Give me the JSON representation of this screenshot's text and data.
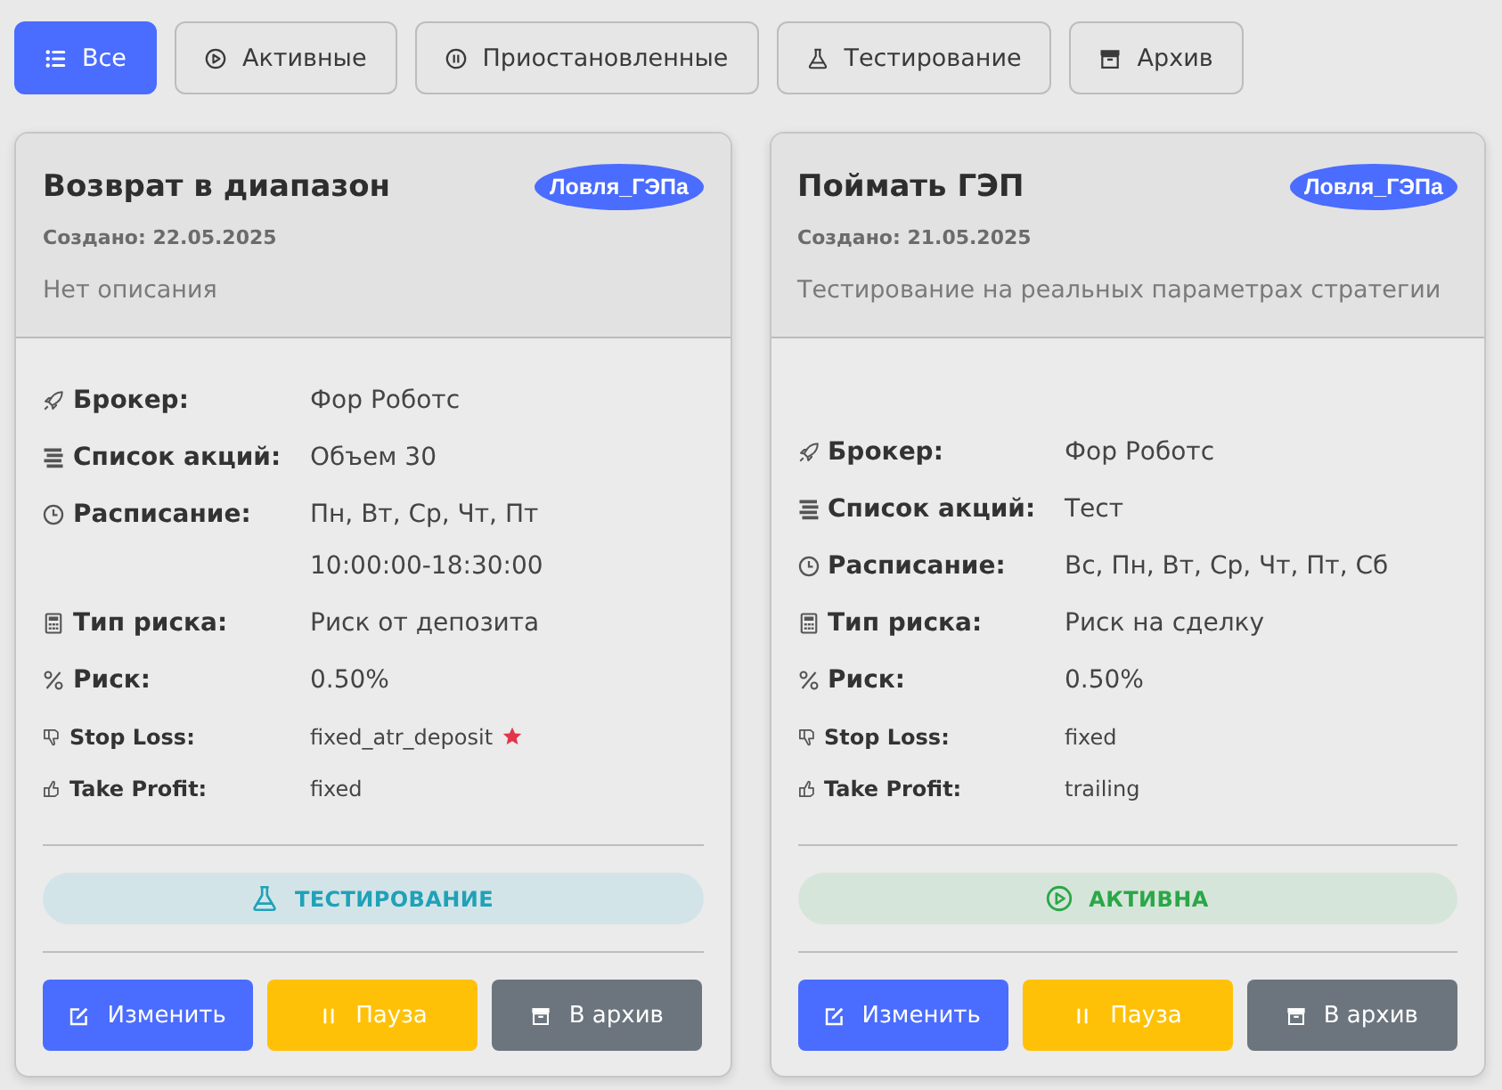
{
  "filters": [
    {
      "kind": "all",
      "label": "Все",
      "selected": true
    },
    {
      "kind": "active",
      "label": "Активные",
      "selected": false
    },
    {
      "kind": "paused",
      "label": "Приостановленные",
      "selected": false
    },
    {
      "kind": "testing",
      "label": "Тестирование",
      "selected": false
    },
    {
      "kind": "archive",
      "label": "Архив",
      "selected": false
    }
  ],
  "cards": [
    {
      "title": "Возврат в диапазон",
      "tag": "Ловля_ГЭПа",
      "created": "Создано: 22.05.2025",
      "description": "Нет описания",
      "details": [
        {
          "kind": "broker",
          "label": "Брокер:",
          "values": [
            "Фор Роботс"
          ],
          "starred": false
        },
        {
          "kind": "stocks",
          "label": "Список акций:",
          "values": [
            "Объем 30"
          ],
          "starred": false
        },
        {
          "kind": "schedule",
          "label": "Расписание:",
          "values": [
            "Пн, Вт, Ср, Чт, Пт",
            "10:00:00-18:30:00"
          ],
          "starred": false
        },
        {
          "kind": "risk_type",
          "label": "Тип риска:",
          "values": [
            "Риск от депозита"
          ],
          "starred": false
        },
        {
          "kind": "risk",
          "label": "Риск:",
          "values": [
            "0.50%"
          ],
          "starred": false
        },
        {
          "kind": "stop_loss",
          "label": "Stop Loss:",
          "values": [
            "fixed_atr_deposit"
          ],
          "starred": true
        },
        {
          "kind": "take_profit",
          "label": "Take Profit:",
          "values": [
            "fixed"
          ],
          "starred": false
        }
      ],
      "status": {
        "kind": "testing",
        "label": "ТЕСТИРОВАНИЕ"
      },
      "actions": [
        {
          "kind": "edit",
          "label": "Изменить"
        },
        {
          "kind": "pause",
          "label": "Пауза"
        },
        {
          "kind": "archive",
          "label": "В архив"
        }
      ]
    },
    {
      "title": "Поймать ГЭП",
      "tag": "Ловля_ГЭПа",
      "created": "Создано: 21.05.2025",
      "description": "Тестирование на реальных параметрах стратегии",
      "details": [
        {
          "kind": "broker",
          "label": "Брокер:",
          "values": [
            "Фор Роботс"
          ],
          "starred": false
        },
        {
          "kind": "stocks",
          "label": "Список акций:",
          "values": [
            "Тест"
          ],
          "starred": false
        },
        {
          "kind": "schedule",
          "label": "Расписание:",
          "values": [
            "Вс, Пн, Вт, Ср, Чт, Пт, Сб"
          ],
          "starred": false
        },
        {
          "kind": "risk_type",
          "label": "Тип риска:",
          "values": [
            "Риск на сделку"
          ],
          "starred": false
        },
        {
          "kind": "risk",
          "label": "Риск:",
          "values": [
            "0.50%"
          ],
          "starred": false
        },
        {
          "kind": "stop_loss",
          "label": "Stop Loss:",
          "values": [
            "fixed"
          ],
          "starred": false
        },
        {
          "kind": "take_profit",
          "label": "Take Profit:",
          "values": [
            "trailing"
          ],
          "starred": false
        }
      ],
      "status": {
        "kind": "active",
        "label": "АКТИВНА"
      },
      "actions": [
        {
          "kind": "edit",
          "label": "Изменить"
        },
        {
          "kind": "pause",
          "label": "Пауза"
        },
        {
          "kind": "archive",
          "label": "В архив"
        }
      ]
    }
  ]
}
